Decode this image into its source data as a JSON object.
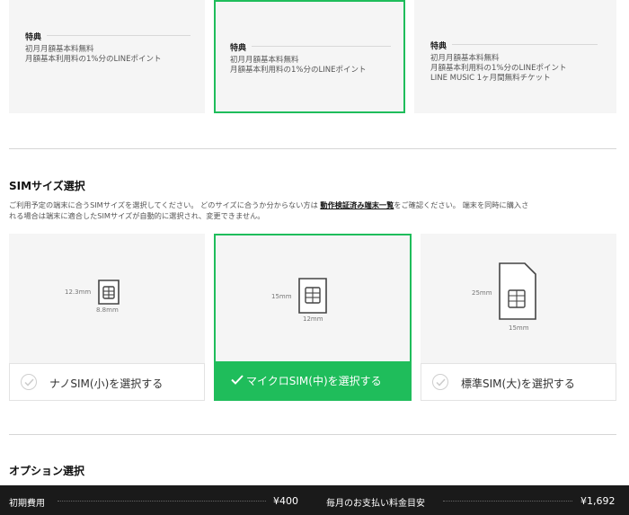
{
  "plans": [
    {
      "perk_title": "特典",
      "perks": [
        "初月月額基本料無料",
        "月額基本利用料の1%分のLINEポイント"
      ]
    },
    {
      "perk_title": "特典",
      "perks": [
        "初月月額基本料無料",
        "月額基本利用料の1%分のLINEポイント"
      ]
    },
    {
      "perk_title": "特典",
      "perks": [
        "初月月額基本料無料",
        "月額基本利用料の1%分のLINEポイント",
        "LINE MUSIC 1ヶ月間無料チケット"
      ]
    }
  ],
  "sim_section": {
    "title": "SIMサイズ選択",
    "desc_1": "ご利用予定の端末に合うSIMサイズを選択してください。 どのサイズに合うか分からない方は ",
    "desc_link": "動作検証済み端末一覧",
    "desc_2": "をご確認ください。 端末を同時に購入さ",
    "desc_3": "れる場合は端末に適合したSIMサイズが自動的に選択され、変更できません。",
    "options": [
      {
        "label": "ナノSIM(小)を選択する",
        "h": "12.3mm",
        "w": "8.8mm",
        "selected": false
      },
      {
        "label": "マイクロSIM(中)を選択する",
        "h": "15mm",
        "w": "12mm",
        "selected": true
      },
      {
        "label": "標準SIM(大)を選択する",
        "h": "25mm",
        "w": "15mm",
        "selected": false
      }
    ]
  },
  "option_section": {
    "title": "オプション選択"
  },
  "footer": {
    "initial_label": "初期費用",
    "initial_value": "¥400",
    "monthly_label": "毎月のお支払い料金目安",
    "monthly_value": "¥1,692"
  },
  "colors": {
    "accent": "#1fbd5b",
    "footer_bg": "#1a1a1a"
  }
}
